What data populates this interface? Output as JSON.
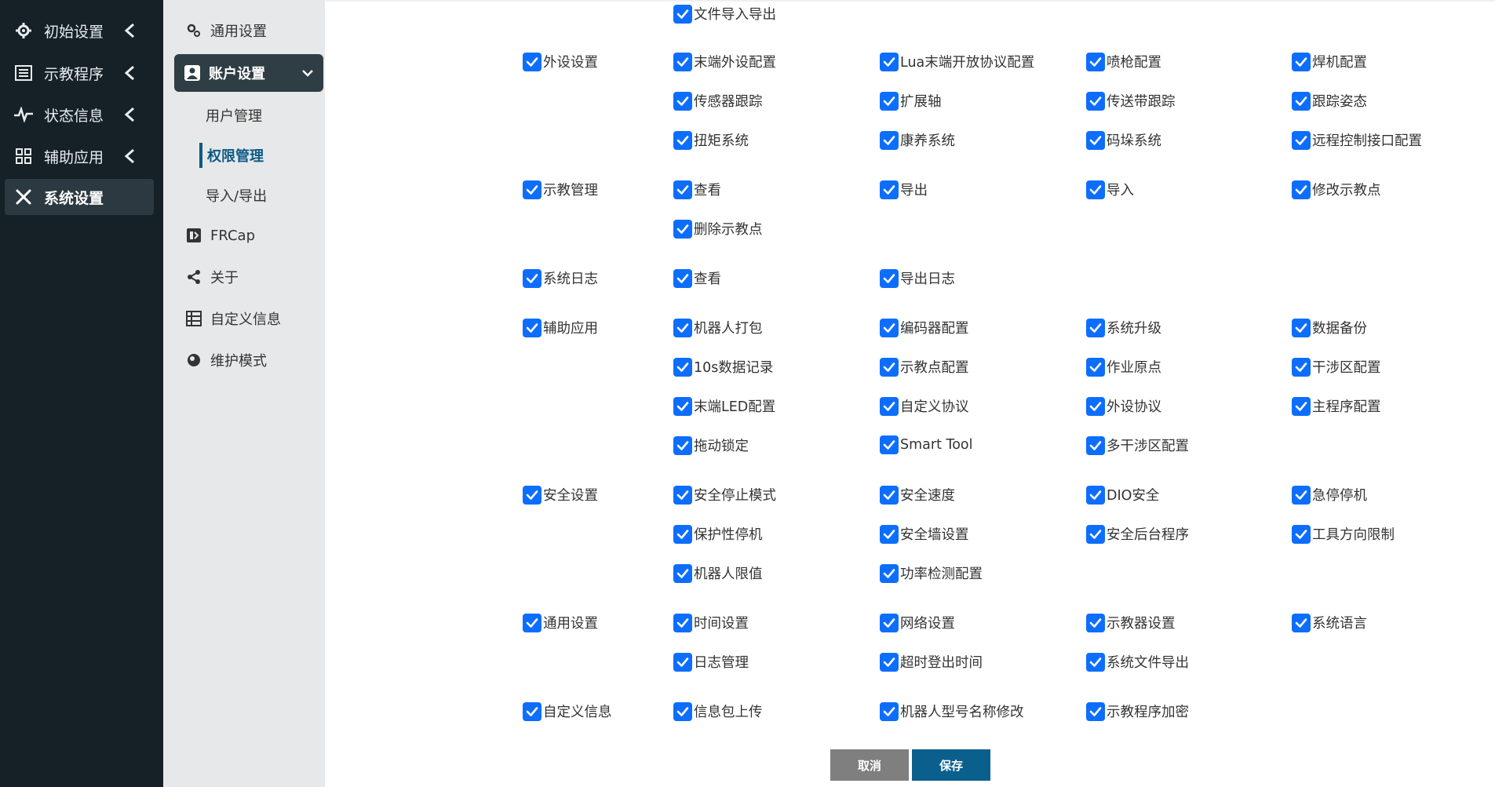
{
  "nav": {
    "items": [
      {
        "label": "初始设置",
        "icon": "gear-icon"
      },
      {
        "label": "示教程序",
        "icon": "list-icon"
      },
      {
        "label": "状态信息",
        "icon": "pulse-icon"
      },
      {
        "label": "辅助应用",
        "icon": "grid-icon"
      },
      {
        "label": "系统设置",
        "icon": "tools-icon"
      }
    ]
  },
  "subnav": {
    "items": [
      {
        "label": "通用设置",
        "icon": "gears-icon"
      },
      {
        "label": "账户设置",
        "icon": "user-icon"
      },
      {
        "label": "FRCap",
        "icon": "frcap-icon"
      },
      {
        "label": "关于",
        "icon": "share-icon"
      },
      {
        "label": "自定义信息",
        "icon": "table-icon"
      },
      {
        "label": "维护模式",
        "icon": "maintenance-icon"
      }
    ],
    "children": [
      {
        "label": "用户管理"
      },
      {
        "label": "权限管理"
      },
      {
        "label": "导入/导出"
      }
    ]
  },
  "permissions": {
    "top_partial": "文件导入导出",
    "groups": [
      {
        "label": "外设设置",
        "items": [
          "末端外设配置",
          "Lua末端开放协议配置",
          "喷枪配置",
          "焊机配置",
          "传感器跟踪",
          "扩展轴",
          "传送带跟踪",
          "跟踪姿态",
          "扭矩系统",
          "康养系统",
          "码垛系统",
          "远程控制接口配置"
        ]
      },
      {
        "label": "示教管理",
        "items": [
          "查看",
          "导出",
          "导入",
          "修改示教点",
          "删除示教点"
        ]
      },
      {
        "label": "系统日志",
        "items": [
          "查看",
          "导出日志"
        ]
      },
      {
        "label": "辅助应用",
        "items": [
          "机器人打包",
          "编码器配置",
          "系统升级",
          "数据备份",
          "10s数据记录",
          "示教点配置",
          "作业原点",
          "干涉区配置",
          "末端LED配置",
          "自定义协议",
          "外设协议",
          "主程序配置",
          "拖动锁定",
          "Smart Tool",
          "多干涉区配置"
        ]
      },
      {
        "label": "安全设置",
        "items": [
          "安全停止模式",
          "安全速度",
          "DIO安全",
          "急停停机",
          "保护性停机",
          "安全墙设置",
          "安全后台程序",
          "工具方向限制",
          "机器人限值",
          "功率检测配置"
        ]
      },
      {
        "label": "通用设置",
        "items": [
          "时间设置",
          "网络设置",
          "示教器设置",
          "系统语言",
          "日志管理",
          "超时登出时间",
          "系统文件导出"
        ]
      },
      {
        "label": "自定义信息",
        "items": [
          "信息包上传",
          "机器人型号名称修改",
          "示教程序加密"
        ]
      }
    ]
  },
  "buttons": {
    "cancel": "取消",
    "save": "保存"
  },
  "colors": {
    "nav_bg": "#152127",
    "sub_bg": "#e7e8e9",
    "checkbox": "#0d6efd",
    "save": "#0b5f8d",
    "cancel": "#7f7f7f"
  }
}
